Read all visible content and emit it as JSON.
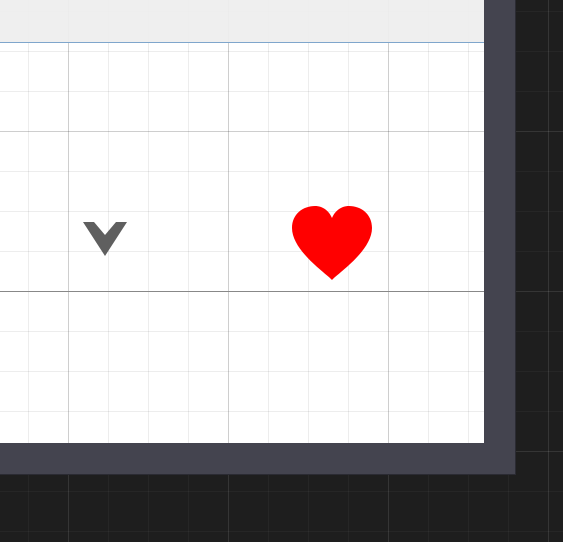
{
  "canvas": {
    "background_color": "#1e1e1e",
    "frame_color": "#44444f"
  },
  "artboard": {
    "background_color": "#ffffff",
    "top_bar_color": "#eeeeee",
    "top_bar_border_color": "#7fa6cc",
    "divider_color": "#888888"
  },
  "icons": {
    "chevron": {
      "name": "chevron-down-icon",
      "color": "#5f5f5f"
    },
    "heart": {
      "name": "heart-icon",
      "color": "#ff0000"
    }
  }
}
